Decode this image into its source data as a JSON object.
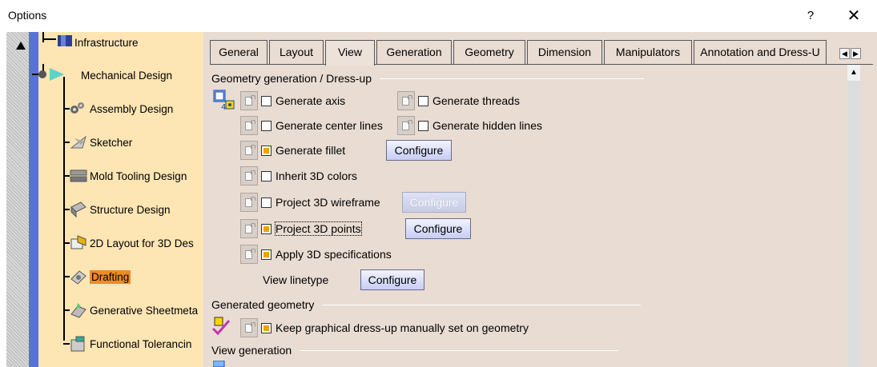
{
  "window": {
    "title": "Options",
    "help": "?",
    "close": "✕"
  },
  "tree": {
    "items": [
      {
        "label": "Infrastructure",
        "selected": false
      },
      {
        "label": "Mechanical Design",
        "selected": false
      },
      {
        "label": "Assembly Design",
        "selected": false
      },
      {
        "label": "Sketcher",
        "selected": false
      },
      {
        "label": "Mold Tooling Design",
        "selected": false
      },
      {
        "label": "Structure Design",
        "selected": false
      },
      {
        "label": "2D Layout for 3D Des",
        "selected": false
      },
      {
        "label": "Drafting",
        "selected": true
      },
      {
        "label": "Generative Sheetmeta",
        "selected": false
      },
      {
        "label": "Functional Tolerancin",
        "selected": false
      }
    ]
  },
  "tabs": [
    "General",
    "Layout",
    "View",
    "Generation",
    "Geometry",
    "Dimension",
    "Manipulators",
    "Annotation and Dress-U"
  ],
  "active_tab": "View",
  "sections": {
    "geometry_generation": "Geometry generation / Dress-up",
    "generated_geometry": "Generated geometry",
    "view_generation": "View generation"
  },
  "options": {
    "generate_axis": {
      "label": "Generate axis",
      "checked": false
    },
    "generate_threads": {
      "label": "Generate threads",
      "checked": false
    },
    "generate_center_lines": {
      "label": "Generate center lines",
      "checked": false
    },
    "generate_hidden_lines": {
      "label": "Generate hidden lines",
      "checked": false
    },
    "generate_fillet": {
      "label": "Generate fillet",
      "checked": true
    },
    "inherit_3d_colors": {
      "label": "Inherit 3D colors",
      "checked": false
    },
    "project_3d_wireframe": {
      "label": "Project 3D wireframe",
      "checked": false
    },
    "project_3d_points": {
      "label": "Project 3D points",
      "checked": true
    },
    "apply_3d_specifications": {
      "label": "Apply 3D specifications",
      "checked": true
    },
    "view_linetype": {
      "label": "View linetype"
    },
    "keep_graphical_dressup": {
      "label": "Keep graphical dress-up manually set on geometry",
      "checked": true
    }
  },
  "buttons": {
    "configure": "Configure"
  },
  "colors": {
    "tree_bg": "#fde5b4",
    "panel_bg": "#e8dcd3",
    "selected": "#f08a24",
    "check_on": "#f0a000",
    "scroll_thumb": "#5a72d8"
  }
}
